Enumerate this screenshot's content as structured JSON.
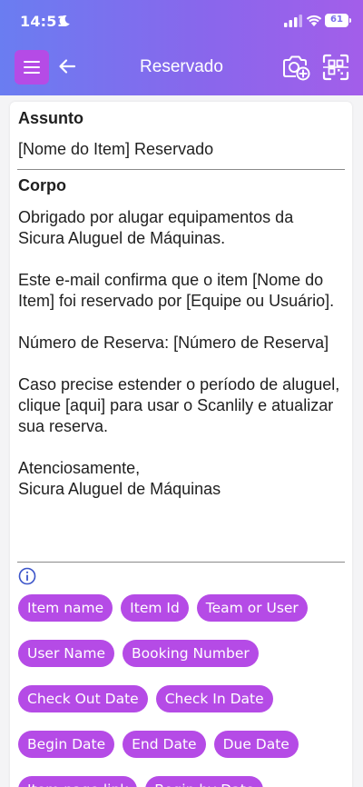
{
  "status_bar": {
    "time": "14:51",
    "battery": "61"
  },
  "nav": {
    "title": "Reservado"
  },
  "form": {
    "subject_label": "Assunto",
    "subject_value": "[Nome do Item] Reservado",
    "body_label": "Corpo",
    "body_paragraphs": [
      "Obrigado por alugar equipamentos da Sicura Aluguel de Máquinas.",
      "Este e-mail confirma que o item [Nome do Item] foi reservado por [Equipe ou Usuário].",
      "Número de Reserva: [Número de Reserva]",
      "Caso precise estender o período de aluguel, clique [aqui] para usar o Scanlily e atualizar sua reserva.",
      "Atenciosamente,",
      "Sicura Aluguel de Máquinas"
    ]
  },
  "chips": {
    "rows": [
      [
        "Item name",
        "Item Id",
        "Team or User"
      ],
      [
        "User Name",
        "Booking Number"
      ],
      [
        "Check Out Date",
        "Check In Date"
      ],
      [
        "Begin Date",
        "End Date",
        "Due Date"
      ],
      [
        "Item page link",
        "Begin by Date"
      ]
    ]
  },
  "colors": {
    "accent": "#b54be6",
    "header_start": "#6a7df1",
    "header_end": "#a35eea"
  }
}
